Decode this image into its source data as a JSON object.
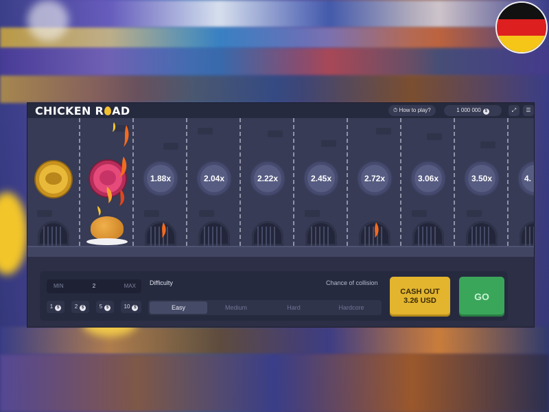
{
  "header": {
    "logo_left": "CHICKEN R",
    "logo_right": "AD",
    "how_to_play": "How to play?",
    "balance": "1 000 000",
    "balance_currency": "$",
    "fullscreen_icon": "fullscreen-icon",
    "menu_icon": "menu-icon"
  },
  "lanes": {
    "multipliers": [
      "1.88x",
      "2.04x",
      "2.22x",
      "2.45x",
      "2.72x",
      "3.06x",
      "3.50x",
      "4."
    ]
  },
  "bet": {
    "min_label": "MIN",
    "value": "2",
    "max_label": "MAX",
    "quick_amounts": [
      "1",
      "2",
      "5",
      "10"
    ],
    "quick_currency": "$"
  },
  "difficulty": {
    "label": "Difficulty",
    "collision_label": "Chance of collision",
    "options": [
      "Easy",
      "Medium",
      "Hard",
      "Hardcore"
    ],
    "selected": "Easy"
  },
  "actions": {
    "cashout_line1": "CASH OUT",
    "cashout_line2": "3.26 USD",
    "go": "GO"
  },
  "colors": {
    "accent_gold": "#e3b52e",
    "go_green": "#3aa65a",
    "panel": "#262a3f"
  },
  "flag_icon": "germany-flag-icon"
}
